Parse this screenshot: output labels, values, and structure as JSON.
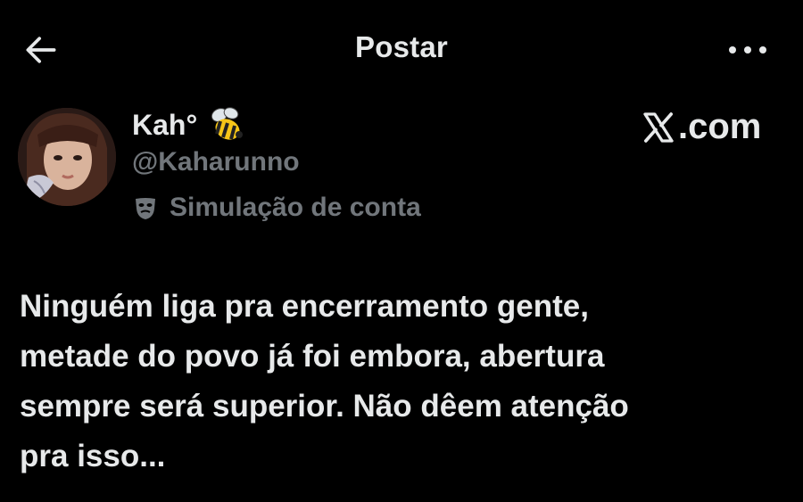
{
  "header": {
    "title": "Postar",
    "back_icon": "arrow-left-icon",
    "more_icon": "more-horizontal-icon"
  },
  "post": {
    "author": {
      "name": "Kah°",
      "emoji_icon": "bee-icon",
      "handle": "@Kaharunno",
      "label_icon": "theater-mask-icon",
      "label": "Simulação de conta"
    },
    "watermark": ".com",
    "watermark_icon": "x-logo-icon",
    "text_lines": [
      "Ninguém liga pra encerramento gente,",
      "metade do povo já foi embora, abertura",
      "sempre será superior. Não dêem atenção",
      "pra isso..."
    ]
  },
  "colors": {
    "background": "#000000",
    "primary_text": "#e7e9ea",
    "secondary_text": "#71767b"
  }
}
